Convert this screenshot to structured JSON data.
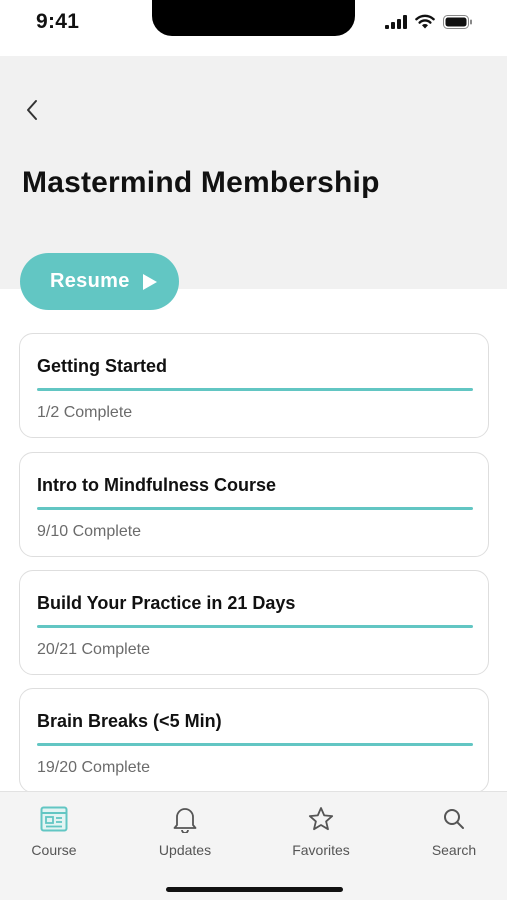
{
  "status_bar": {
    "time": "9:41"
  },
  "header": {
    "title": "Mastermind Membership",
    "back_icon": "chevron-left-icon"
  },
  "resume": {
    "label": "Resume",
    "icon": "play-icon",
    "color": "#62c6c3"
  },
  "sections": [
    {
      "title": "Getting Started",
      "status": "1/2 Complete",
      "progress": 1.0
    },
    {
      "title": "Intro to Mindfulness Course",
      "status": "9/10 Complete",
      "progress": 1.0
    },
    {
      "title": "Build Your Practice in 21 Days",
      "status": "20/21 Complete",
      "progress": 1.0
    },
    {
      "title": "Brain Breaks (<5 Min)",
      "status": "19/20 Complete",
      "progress": 1.0
    }
  ],
  "tabs": [
    {
      "label": "Course",
      "icon": "course-icon",
      "active": true
    },
    {
      "label": "Updates",
      "icon": "bell-icon",
      "active": false
    },
    {
      "label": "Favorites",
      "icon": "star-icon",
      "active": false
    },
    {
      "label": "Search",
      "icon": "search-icon",
      "active": false
    }
  ],
  "colors": {
    "accent": "#62c6c3",
    "header_bg": "#f1f1f1"
  }
}
